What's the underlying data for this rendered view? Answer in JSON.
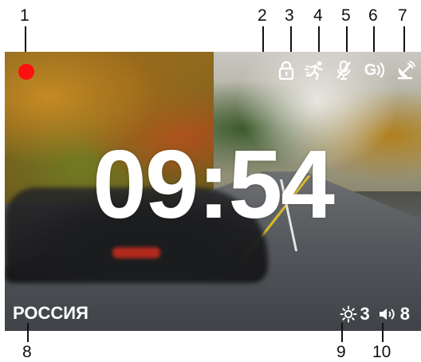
{
  "callouts": {
    "c1": "1",
    "c2": "2",
    "c3": "3",
    "c4": "4",
    "c5": "5",
    "c6": "6",
    "c7": "7",
    "c8": "8",
    "c9": "9",
    "c10": "10"
  },
  "screen": {
    "time": "09:54",
    "region": "РОССИЯ",
    "status_icons": [
      "record-dot",
      "lock-icon",
      "motion-detection-icon",
      "mic-off-icon",
      "gsensor-icon",
      "gps-satellite-icon"
    ],
    "gsensor_label": "G",
    "brightness_value": "3",
    "volume_value": "8",
    "colors": {
      "record": "#ff1010",
      "overlay_text": "#ffffff",
      "callout_text": "#111111"
    }
  }
}
